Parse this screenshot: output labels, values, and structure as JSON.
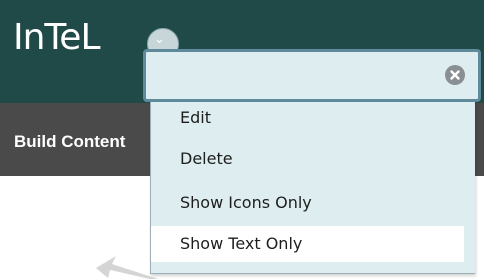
{
  "header": {
    "app_title": "InTeL",
    "toggle_glyph": "⌄",
    "toggle_icon": "chevron-down-icon",
    "sub_bar_label": "Build Content"
  },
  "context_menu": {
    "search_value": "",
    "search_placeholder": "",
    "clear_icon": "clear-icon",
    "items": [
      {
        "label": "Edit"
      },
      {
        "label": "Delete"
      },
      {
        "label": "Show Icons Only"
      },
      {
        "label": "Show Text Only",
        "highlighted": true
      }
    ]
  },
  "colors": {
    "top_bar": "#1f4a48",
    "sub_bar": "#4a4a4a",
    "menu_background": "#deedef",
    "field_border": "#5e8a9c",
    "highlight_row": "#ffffff"
  }
}
